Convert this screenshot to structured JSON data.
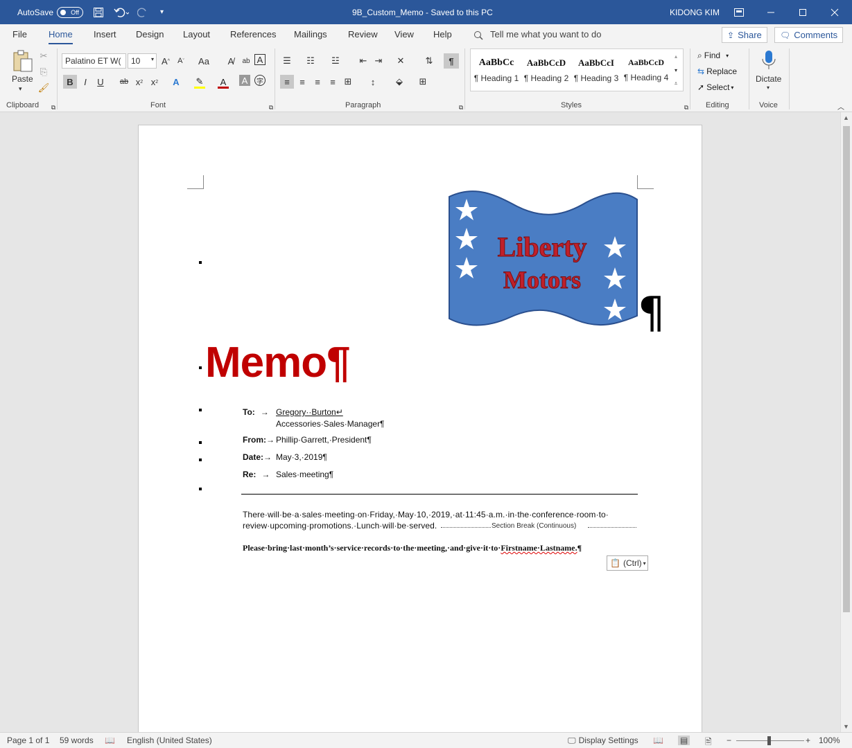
{
  "titlebar": {
    "autosave_label": "AutoSave",
    "autosave_state": "Off",
    "doc_title": "9B_Custom_Memo  -  Saved to this PC",
    "user": "KIDONG KIM",
    "bg_color": "#2b579a"
  },
  "menu": {
    "items": [
      "File",
      "Home",
      "Insert",
      "Design",
      "Layout",
      "References",
      "Mailings",
      "Review",
      "View",
      "Help"
    ],
    "active": "Home",
    "tell_me": "Tell me what you want to do",
    "share": "Share",
    "comments": "Comments"
  },
  "ribbon": {
    "clipboard": {
      "label": "Clipboard",
      "paste": "Paste"
    },
    "font": {
      "label": "Font",
      "font_name": "Palatino ET W(",
      "font_size": "10"
    },
    "paragraph": {
      "label": "Paragraph"
    },
    "styles": {
      "label": "Styles",
      "items": [
        {
          "sample": "AaBbCc",
          "name": "¶ Heading 1"
        },
        {
          "sample": "AaBbCcD",
          "name": "¶ Heading 2"
        },
        {
          "sample": "AaBbCcI",
          "name": "¶ Heading 3"
        },
        {
          "sample": "AaBbCcD",
          "name": "¶ Heading 4"
        }
      ]
    },
    "editing": {
      "label": "Editing",
      "find": "Find",
      "replace": "Replace",
      "select": "Select"
    },
    "voice": {
      "label": "Voice",
      "dictate": "Dictate"
    }
  },
  "document": {
    "logo": {
      "line1": "Liberty",
      "line2": "Motors"
    },
    "memo_title": "Memo¶",
    "to_label": "To:",
    "to_name": "Gregory··Burton",
    "to_title": "Accessories·Sales·Manager¶",
    "from_label": "From:",
    "from_value": "Phillip·Garrett,·President¶",
    "date_label": "Date:",
    "date_value": "May·3,·2019¶",
    "re_label": "Re:",
    "re_value": "Sales·meeting¶",
    "body_line1": "There·will·be·a·sales·meeting·on·Friday,·May·10,·2019,·at·11:45·a.m.·in·the·conference·room·to·",
    "body_line2": "review·upcoming·promotions.·Lunch·will·be·served.",
    "section_break": "Section Break (Continuous)",
    "serif_line_pre": "Please·bring·last·month’s·service·records·to·the·meeting,·and·give·it·to·",
    "serif_line_name": "Firstname·Lastname.",
    "serif_line_end": "¶",
    "ctrl_label": "(Ctrl)"
  },
  "statusbar": {
    "page": "Page 1 of 1",
    "words": "59 words",
    "language": "English (United States)",
    "display_settings": "Display Settings",
    "zoom": "100%"
  }
}
